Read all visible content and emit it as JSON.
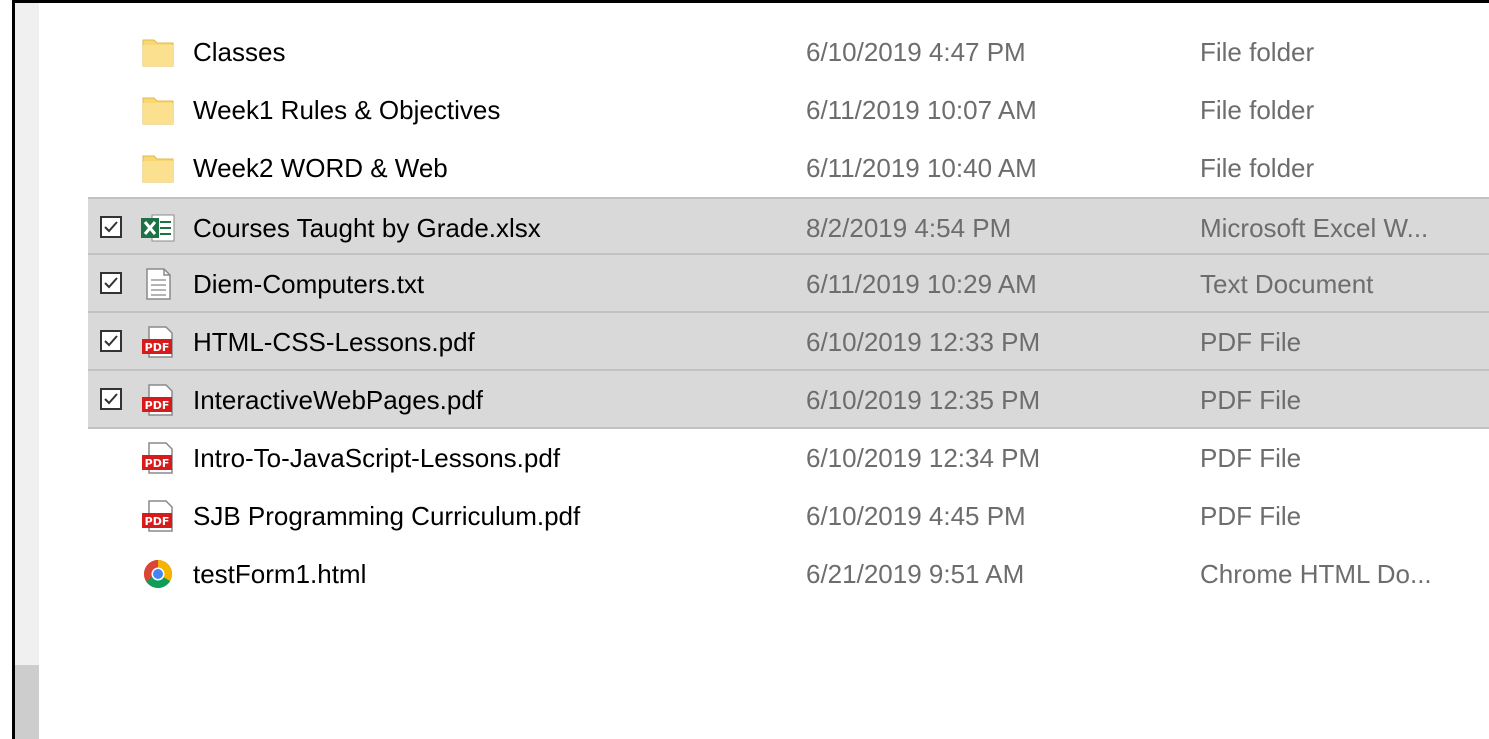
{
  "files": [
    {
      "name": "Classes",
      "date": "6/10/2019 4:47 PM",
      "type": "File folder",
      "icon": "folder-icon",
      "checked": false
    },
    {
      "name": "Week1 Rules & Objectives",
      "date": "6/11/2019 10:07 AM",
      "type": "File folder",
      "icon": "folder-icon",
      "checked": false
    },
    {
      "name": "Week2 WORD & Web",
      "date": "6/11/2019 10:40 AM",
      "type": "File folder",
      "icon": "folder-icon",
      "checked": false
    },
    {
      "name": "Courses Taught by Grade.xlsx",
      "date": "8/2/2019 4:54 PM",
      "type": "Microsoft Excel W...",
      "icon": "excel-file-icon",
      "checked": true
    },
    {
      "name": "Diem-Computers.txt",
      "date": "6/11/2019 10:29 AM",
      "type": "Text Document",
      "icon": "text-file-icon",
      "checked": true
    },
    {
      "name": "HTML-CSS-Lessons.pdf",
      "date": "6/10/2019 12:33 PM",
      "type": "PDF File",
      "icon": "pdf-file-icon",
      "checked": true
    },
    {
      "name": "InteractiveWebPages.pdf",
      "date": "6/10/2019 12:35 PM",
      "type": "PDF File",
      "icon": "pdf-file-icon",
      "checked": true
    },
    {
      "name": "Intro-To-JavaScript-Lessons.pdf",
      "date": "6/10/2019 12:34 PM",
      "type": "PDF File",
      "icon": "pdf-file-icon",
      "checked": false
    },
    {
      "name": "SJB Programming Curriculum.pdf",
      "date": "6/10/2019 4:45 PM",
      "type": "PDF File",
      "icon": "pdf-file-icon",
      "checked": false
    },
    {
      "name": "testForm1.html",
      "date": "6/21/2019 9:51 AM",
      "type": "Chrome HTML Do...",
      "icon": "chrome-html-file-icon",
      "checked": false
    }
  ],
  "colors": {
    "selection_bg": "#d9d9d9",
    "folder": "#f8d775",
    "excel_green": "#1e7145",
    "pdf_red": "#d71a1a",
    "secondary_text": "#6d6d6d"
  }
}
